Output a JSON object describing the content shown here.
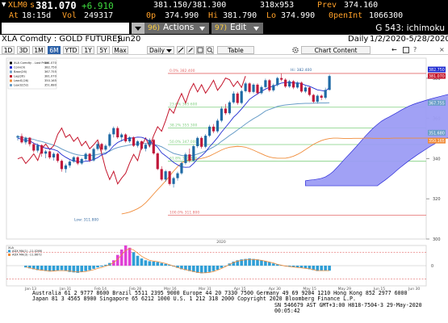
{
  "quote": {
    "ticker": "XLM0",
    "price_prefix": "s",
    "price": "381.070",
    "change": "+6.910",
    "bid_ask": "381.150/381.300",
    "size": "318x953",
    "prev_label": "Prev",
    "prev": "374.160",
    "at_label": "At",
    "time": "18:15d",
    "vol_label": "Vol",
    "vol": "249317",
    "open_label": "0p",
    "open": "374.990",
    "hi_label": "Hi",
    "hi": "381.790",
    "lo_label": "Lo",
    "lo": "374.990",
    "oi_label": "0penInt",
    "oi": "1066300"
  },
  "menu": {
    "dropdown_icon": "dropdown-arrow-icon",
    "actions_num": "96)",
    "actions_label": "Actions",
    "edit_num": "97)",
    "edit_label": "Edit",
    "page_label": "G 543: ichimoku"
  },
  "security": {
    "name": "XLA Comdty : GOLD FUTURES",
    "contract": "Jun20",
    "title": "XLA Comdty",
    "period": "Daily",
    "range": "1/2/2020-5/28/2020"
  },
  "toolbar": {
    "periods": [
      "1D",
      "3D",
      "1M",
      "6M",
      "YTD",
      "1Y",
      "5Y",
      "Max"
    ],
    "active_period": "6M",
    "freq": "Daily",
    "table": "Table",
    "chart_content": "Chart Content"
  },
  "colors": {
    "accent_amber": "#ffa028",
    "up_candle": "#1f6aa5",
    "down_candle": "#c0183a",
    "conversion": "#1f2bd1",
    "base": "#6a9ec8",
    "lagging": "#c4152c",
    "leading_a": "#f08c3a",
    "leading_b": "#6a9ec8",
    "cloud": "#9c9cf4"
  },
  "chart_data": [
    {
      "type": "line",
      "legend": [
        "XLA Comdty - Last Price",
        "Conv(9)",
        "Base(26)",
        "Lag(26)",
        "Lead1(26)",
        "Lead2(52)"
      ],
      "legend_values": [
        "381.070",
        "382.750",
        "367.755",
        "381.070",
        "350.165",
        "351.680"
      ],
      "hlines": [
        {
          "label": "0.0%",
          "value": 382.4,
          "color": "#e36a6a"
        },
        {
          "label": "23.6%",
          "value": 365.6,
          "color": "#7fcf7f"
        },
        {
          "label": "38.2%",
          "value": 355.3,
          "color": "#7fcf7f"
        },
        {
          "label": "50.0%",
          "value": 347.0,
          "color": "#7fcf7f"
        },
        {
          "label": "61.8%",
          "value": 338.7,
          "color": "#7fcf7f"
        },
        {
          "label": "100.0%",
          "value": 311.8,
          "color": "#e36a6a"
        }
      ],
      "annotations": {
        "high": "Hi: 382.400",
        "low": "Low: 311.800"
      },
      "ylim": [
        300,
        390
      ],
      "yticks": [
        300,
        320,
        340,
        360,
        380
      ],
      "right_labels": [
        "382.750",
        "381.070",
        "367.755",
        "351.680",
        "350.165"
      ],
      "candles": [
        [
          350.5,
          351.8,
          349.0,
          351.2
        ],
        [
          351.2,
          352.5,
          347.5,
          348.1
        ],
        [
          348.1,
          351.0,
          347.0,
          350.4
        ],
        [
          350.4,
          350.8,
          346.1,
          347.2
        ],
        [
          347.2,
          348.0,
          343.1,
          344.0
        ],
        [
          344.0,
          347.5,
          343.0,
          346.7
        ],
        [
          346.7,
          347.1,
          341.0,
          342.5
        ],
        [
          342.5,
          344.4,
          340.2,
          343.6
        ],
        [
          343.6,
          344.0,
          339.8,
          340.6
        ],
        [
          340.6,
          343.2,
          339.0,
          342.4
        ],
        [
          342.4,
          343.0,
          338.0,
          338.9
        ],
        [
          338.9,
          339.6,
          333.5,
          334.8
        ],
        [
          334.8,
          337.5,
          333.0,
          336.6
        ],
        [
          336.6,
          339.2,
          335.5,
          338.5
        ],
        [
          338.5,
          341.3,
          337.9,
          340.7
        ],
        [
          340.7,
          341.2,
          336.8,
          337.6
        ],
        [
          337.6,
          340.4,
          336.9,
          339.8
        ],
        [
          339.8,
          343.1,
          339.0,
          342.4
        ],
        [
          342.4,
          342.9,
          338.2,
          339.1
        ],
        [
          339.1,
          345.5,
          338.5,
          344.8
        ],
        [
          344.8,
          348.2,
          344.0,
          347.3
        ],
        [
          347.3,
          347.9,
          343.6,
          344.5
        ],
        [
          344.5,
          347.2,
          343.8,
          346.4
        ],
        [
          346.4,
          353.0,
          345.6,
          352.1
        ],
        [
          352.1,
          356.0,
          350.5,
          355.2
        ],
        [
          355.2,
          356.1,
          349.8,
          350.6
        ],
        [
          350.6,
          352.8,
          348.5,
          352.0
        ],
        [
          352.0,
          352.6,
          347.9,
          348.6
        ],
        [
          348.6,
          351.2,
          347.8,
          350.6
        ],
        [
          350.6,
          351.1,
          345.8,
          346.4
        ],
        [
          346.4,
          349.2,
          345.5,
          348.6
        ],
        [
          348.6,
          349.0,
          344.2,
          344.9
        ],
        [
          344.9,
          347.7,
          343.6,
          346.9
        ],
        [
          346.9,
          350.1,
          346.0,
          349.3
        ],
        [
          349.3,
          349.8,
          342.0,
          342.6
        ],
        [
          342.6,
          343.1,
          334.3,
          334.8
        ],
        [
          334.8,
          336.2,
          328.9,
          329.6
        ],
        [
          329.6,
          334.4,
          328.5,
          333.7
        ],
        [
          333.7,
          334.0,
          326.6,
          327.4
        ],
        [
          327.4,
          331.0,
          325.6,
          330.3
        ],
        [
          330.3,
          333.5,
          329.1,
          332.7
        ],
        [
          332.7,
          338.5,
          332.0,
          337.8
        ],
        [
          337.8,
          343.0,
          337.0,
          342.1
        ],
        [
          342.1,
          345.0,
          338.0,
          339.0
        ],
        [
          339.0,
          346.8,
          338.5,
          346.2
        ],
        [
          346.2,
          351.0,
          345.3,
          350.3
        ],
        [
          350.3,
          351.1,
          345.0,
          345.9
        ],
        [
          345.9,
          352.2,
          345.2,
          351.4
        ],
        [
          351.4,
          356.8,
          350.7,
          355.9
        ],
        [
          355.9,
          357.2,
          352.7,
          353.6
        ],
        [
          353.6,
          359.8,
          352.8,
          358.9
        ],
        [
          358.9,
          366.0,
          358.1,
          364.9
        ],
        [
          364.9,
          367.2,
          361.7,
          362.6
        ],
        [
          362.6,
          368.8,
          361.9,
          368.0
        ],
        [
          368.0,
          373.5,
          367.3,
          372.4
        ],
        [
          372.4,
          373.2,
          366.8,
          367.7
        ],
        [
          367.7,
          374.4,
          367.0,
          373.6
        ],
        [
          373.6,
          378.2,
          372.9,
          377.4
        ],
        [
          377.4,
          378.0,
          372.4,
          373.2
        ],
        [
          373.2,
          377.5,
          372.5,
          376.8
        ],
        [
          376.8,
          377.5,
          371.8,
          372.6
        ],
        [
          372.6,
          376.4,
          371.9,
          375.6
        ],
        [
          375.6,
          379.8,
          375.0,
          379.0
        ],
        [
          379.0,
          379.6,
          373.2,
          374.0
        ],
        [
          374.0,
          377.4,
          373.3,
          376.6
        ],
        [
          376.6,
          380.7,
          375.9,
          380.1
        ],
        [
          380.1,
          382.4,
          378.5,
          379.3
        ],
        [
          379.3,
          380.0,
          375.2,
          375.9
        ],
        [
          375.9,
          379.2,
          375.2,
          378.5
        ],
        [
          378.5,
          379.1,
          374.6,
          375.4
        ],
        [
          375.4,
          378.5,
          374.8,
          377.8
        ],
        [
          377.8,
          378.4,
          372.7,
          373.4
        ],
        [
          373.4,
          376.2,
          372.6,
          375.4
        ],
        [
          375.4,
          375.9,
          371.0,
          371.7
        ],
        [
          371.7,
          372.2,
          367.6,
          368.3
        ],
        [
          368.3,
          372.0,
          367.4,
          371.3
        ],
        [
          371.3,
          371.9,
          369.1,
          370.3
        ],
        [
          370.3,
          375.3,
          369.5,
          374.2
        ],
        [
          374.2,
          381.8,
          374.0,
          381.1
        ]
      ],
      "conversion": [
        350.2,
        349.6,
        349.1,
        348.9,
        347.6,
        346.9,
        345.9,
        345.2,
        344.9,
        344.5,
        343.8,
        342.0,
        340.7,
        339.6,
        338.8,
        338.6,
        338.4,
        338.7,
        338.9,
        339.6,
        340.5,
        341.9,
        342.4,
        344.1,
        346.4,
        348.0,
        349.0,
        349.8,
        350.1,
        350.4,
        350.7,
        350.6,
        349.9,
        348.5,
        347.3,
        345.7,
        342.9,
        341.4,
        339.8,
        338.1,
        336.9,
        335.9,
        335.7,
        335.8,
        337.6,
        339.9,
        341.4,
        343.3,
        345.9,
        348.1,
        350.5,
        353.2,
        355.6,
        358.0,
        360.6,
        362.5,
        364.7,
        367.1,
        369.5,
        370.9,
        372.2,
        373.5,
        374.6,
        375.5,
        376.1,
        376.8,
        377.6,
        377.8,
        378.0,
        377.5,
        377.7,
        377.3,
        376.5,
        376.0,
        375.1,
        374.2,
        373.9,
        373.5,
        375.4
      ],
      "base": [
        351.1,
        350.5,
        350.2,
        349.9,
        349.6,
        348.9,
        348.5,
        347.9,
        347.3,
        346.7,
        345.9,
        344.8,
        343.9,
        343.1,
        342.4,
        341.9,
        341.6,
        341.6,
        341.5,
        341.7,
        342.1,
        342.5,
        343.0,
        343.7,
        344.8,
        345.5,
        346.0,
        346.4,
        346.8,
        347.1,
        347.3,
        347.5,
        347.5,
        347.4,
        347.1,
        346.6,
        345.9,
        344.8,
        343.6,
        342.6,
        342.1,
        341.6,
        341.4,
        341.5,
        341.7,
        342.3,
        343.0,
        343.8,
        344.8,
        345.8,
        347.0,
        348.6,
        350.0,
        351.5,
        352.8,
        354.3,
        355.7,
        357.2,
        358.6,
        359.9,
        361.0,
        362.3,
        363.7,
        364.5,
        365.2,
        366.0,
        366.4,
        366.7,
        366.9,
        367.1,
        367.3,
        367.4,
        367.5,
        367.5,
        367.6,
        367.7,
        367.7,
        367.7,
        367.8
      ],
      "lagging": [
        339.9,
        340.7,
        337.6,
        339.8,
        342.4,
        339.1,
        344.8,
        347.3,
        344.5,
        346.4,
        352.1,
        355.2,
        350.6,
        352.0,
        348.6,
        350.6,
        346.4,
        348.6,
        344.9,
        346.9,
        349.3,
        342.6,
        334.8,
        329.6,
        333.7,
        327.4,
        330.3,
        332.7,
        337.8,
        342.1,
        339.0,
        346.2,
        350.3,
        345.9,
        351.4,
        355.9,
        353.6,
        358.9,
        364.9,
        362.6,
        368.0,
        372.4,
        367.7,
        373.6,
        377.4,
        373.2,
        376.8,
        372.6,
        375.6,
        379.0,
        374.0,
        376.6,
        380.1,
        379.3,
        375.9,
        378.5,
        375.4,
        381.1
      ],
      "leading_a": [
        312.5,
        312.9,
        313.4,
        314.2,
        315.1,
        316.3,
        318.0,
        320.1,
        322.4,
        324.6,
        326.7,
        328.9,
        331.3,
        333.8,
        336.0,
        337.8,
        339.0,
        339.4,
        339.5,
        339.7,
        340.1,
        340.6,
        341.3,
        342.3,
        343.3,
        344.3,
        345.1,
        345.7,
        345.9,
        346.1,
        346.0,
        345.7,
        345.0,
        344.2,
        343.3,
        342.4,
        341.5,
        340.8,
        340.4,
        340.2,
        340.2,
        340.2,
        340.6,
        341.2,
        342.1,
        343.2,
        344.5,
        345.8,
        347.1,
        348.1,
        349.0,
        349.6,
        350.0,
        350.2,
        350.2,
        350.1,
        350.0,
        350.0,
        350.1,
        350.1,
        350.1,
        350.2,
        350.2,
        350.1,
        350.1,
        350.1,
        350.1,
        350.1,
        350.2,
        350.2,
        350.2,
        350.2,
        350.2,
        350.2,
        350.2,
        350.2,
        350.2,
        350.2,
        350.2,
        350.2,
        350.1,
        350.1,
        350.1,
        350.2,
        350.2,
        350.2,
        350.2,
        350.1,
        350.1,
        350.2,
        350.2,
        350.2,
        350.2,
        350.2,
        350.2,
        350.1,
        350.2,
        350.1,
        350.1,
        350.2,
        350.2,
        350.2,
        350.2,
        350.2,
        350.1
      ],
      "cloud_top": [
        329.0,
        329.3,
        329.5,
        329.8,
        330.2,
        330.9,
        332.1,
        333.7,
        335.8,
        338.0,
        340.2,
        342.3,
        344.4,
        346.6,
        348.9,
        351.2,
        353.3,
        355.3,
        357.0,
        358.6,
        359.8,
        360.8,
        361.9,
        363.0,
        364.2,
        365.2,
        366.2,
        367.0,
        367.7,
        368.3,
        368.9,
        369.5,
        370.1,
        370.6,
        371.1,
        371.6,
        372.1,
        372.6,
        373.1,
        373.6,
        373.9,
        374.2,
        374.5,
        374.5
      ],
      "cloud_bottom": [
        326.5,
        326.5,
        326.5,
        326.5,
        326.5,
        326.5,
        326.5,
        326.5,
        326.5,
        326.5,
        326.5,
        326.5,
        326.5,
        326.5,
        326.5,
        326.5,
        326.5,
        326.5,
        326.5,
        328.0,
        329.4,
        331.0,
        332.6,
        334.4,
        336.0,
        337.6,
        339.1,
        340.5,
        341.9,
        343.2,
        344.5,
        345.8,
        347.0,
        348.2,
        349.2,
        350.0,
        350.5,
        350.9,
        351.1,
        351.3,
        351.5,
        351.6,
        351.7,
        351.7
      ],
      "cloud_start": 72,
      "xlabels": [
        "Jan 13",
        "Jan 31",
        "Feb 14",
        "Feb 28",
        "Mar 16",
        "Mar 31",
        "Apr 15",
        "Apr 30",
        "May 15",
        "May 29",
        "Jun 15",
        "Jun 30"
      ],
      "xlabel_year": "2020"
    },
    {
      "type": "bar",
      "legend": [
        "XLA",
        "ADX MA(1) -11.0266",
        "ADX MA(3) -11.6672"
      ],
      "hlines": [
        {
          "label": "30",
          "value": 30,
          "color": "#e36a6a"
        },
        {
          "label": "0",
          "value": 0,
          "color": "#bbbbbb"
        },
        {
          "label": "-30",
          "value": -30,
          "color": "#e36a6a"
        }
      ],
      "ylim": [
        -45,
        45
      ],
      "values": [
        -4,
        -6,
        -8,
        -10,
        -11,
        -12,
        -13,
        -12,
        -11,
        -10,
        -12,
        -14,
        -15,
        -16,
        -14,
        -12,
        -10,
        -7,
        -4,
        -2,
        2,
        6,
        12,
        24,
        36,
        45,
        40,
        30,
        22,
        16,
        12,
        10,
        9,
        8,
        6,
        4,
        2,
        -2,
        -5,
        -8,
        -10,
        -12,
        -14,
        -16,
        -17,
        -16,
        -14,
        -12,
        -9,
        -5,
        0,
        5,
        9,
        12,
        14,
        15,
        16,
        15,
        14,
        12,
        10,
        8,
        5,
        3,
        1,
        -1,
        -2,
        -3,
        -4,
        -5,
        -6,
        -8,
        -10,
        -12,
        -11,
        -11,
        -11
      ],
      "highlight": [
        22,
        23,
        24,
        25,
        26
      ],
      "ma": [
        -3,
        -5,
        -7,
        -9,
        -10,
        -11,
        -12,
        -12,
        -11,
        -11,
        -11,
        -12,
        -13,
        -14,
        -14,
        -13,
        -11,
        -9,
        -6,
        -4,
        -1,
        2,
        7,
        14,
        24,
        34,
        38,
        35,
        28,
        21,
        16,
        12,
        10,
        9,
        7,
        5,
        2,
        -1,
        -4,
        -7,
        -9,
        -11,
        -13,
        -15,
        -16,
        -16,
        -15,
        -13,
        -10,
        -6,
        -2,
        3,
        7,
        10,
        12,
        13,
        14,
        14,
        13,
        12,
        10,
        8,
        6,
        3,
        1,
        -1,
        -2,
        -3,
        -4,
        -5,
        -6,
        -7,
        -9,
        -11,
        -11,
        -11,
        -11
      ]
    }
  ],
  "footer": {
    "line1": "Australia 61 2 9777 8600 Brazil 5511 2395 9000 Europe 44 20 7330 7500 Germany 49 69 9204 1210 Hong Kong 852 2977 6000",
    "line2": "Japan 81 3 4565 8900       Singapore 65 6212 1000       U.S. 1 212 318 2000              Copyright 2020 Bloomberg Finance L.P.",
    "line3": "SN 546679 AST  GMT+3:00 H818-7504-3 29-May-2020 00:05:42"
  }
}
